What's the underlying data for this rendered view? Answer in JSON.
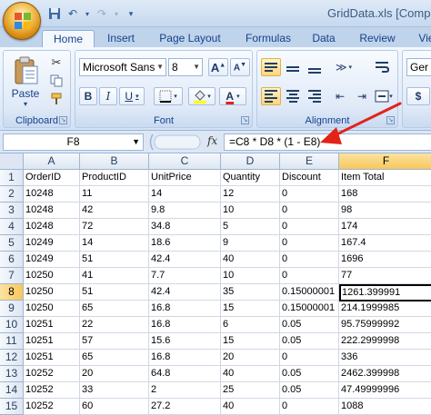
{
  "window": {
    "title": "GridData.xls [Comp"
  },
  "quick_access": {
    "icons": [
      "save-icon",
      "undo-icon",
      "redo-icon",
      "customize-icon"
    ]
  },
  "tabs": [
    {
      "label": "Home",
      "active": true
    },
    {
      "label": "Insert"
    },
    {
      "label": "Page Layout"
    },
    {
      "label": "Formulas"
    },
    {
      "label": "Data"
    },
    {
      "label": "Review"
    },
    {
      "label": "Vie"
    }
  ],
  "ribbon": {
    "clipboard": {
      "label": "Clipboard",
      "paste_label": "Paste"
    },
    "font": {
      "label": "Font",
      "font_name": "Microsoft Sans",
      "font_size": "8"
    },
    "alignment": {
      "label": "Alignment"
    },
    "number": {
      "format_partial": "Ger"
    }
  },
  "formula_bar": {
    "name_box": "F8",
    "fx": "fx",
    "formula": "=C8 * D8 * (1 - E8)"
  },
  "grid": {
    "columns": [
      "A",
      "B",
      "C",
      "D",
      "E",
      "F"
    ],
    "selected_column": "F",
    "selected_row": 8,
    "rows": [
      {
        "num": "1",
        "cells": [
          "OrderID",
          "ProductID",
          "UnitPrice",
          "Quantity",
          "Discount",
          "Item Total"
        ]
      },
      {
        "num": "2",
        "cells": [
          "10248",
          "11",
          "14",
          "12",
          "0",
          "168"
        ]
      },
      {
        "num": "3",
        "cells": [
          "10248",
          "42",
          "9.8",
          "10",
          "0",
          "98"
        ]
      },
      {
        "num": "4",
        "cells": [
          "10248",
          "72",
          "34.8",
          "5",
          "0",
          "174"
        ]
      },
      {
        "num": "5",
        "cells": [
          "10249",
          "14",
          "18.6",
          "9",
          "0",
          "167.4"
        ]
      },
      {
        "num": "6",
        "cells": [
          "10249",
          "51",
          "42.4",
          "40",
          "0",
          "1696"
        ]
      },
      {
        "num": "7",
        "cells": [
          "10250",
          "41",
          "7.7",
          "10",
          "0",
          "77"
        ]
      },
      {
        "num": "8",
        "cells": [
          "10250",
          "51",
          "42.4",
          "35",
          "0.15000001",
          "1261.399991"
        ]
      },
      {
        "num": "9",
        "cells": [
          "10250",
          "65",
          "16.8",
          "15",
          "0.15000001",
          "214.1999985"
        ]
      },
      {
        "num": "10",
        "cells": [
          "10251",
          "22",
          "16.8",
          "6",
          "0.05",
          "95.75999992"
        ]
      },
      {
        "num": "11",
        "cells": [
          "10251",
          "57",
          "15.6",
          "15",
          "0.05",
          "222.2999998"
        ]
      },
      {
        "num": "12",
        "cells": [
          "10251",
          "65",
          "16.8",
          "20",
          "0",
          "336"
        ]
      },
      {
        "num": "13",
        "cells": [
          "10252",
          "20",
          "64.8",
          "40",
          "0.05",
          "2462.399998"
        ]
      },
      {
        "num": "14",
        "cells": [
          "10252",
          "33",
          "2",
          "25",
          "0.05",
          "47.49999996"
        ]
      },
      {
        "num": "15",
        "cells": [
          "10252",
          "60",
          "27.2",
          "40",
          "0",
          "1088"
        ]
      }
    ]
  },
  "colors": {
    "accent": "#15428b",
    "selection": "#f7c75b",
    "annotation_arrow": "#e2231a"
  }
}
